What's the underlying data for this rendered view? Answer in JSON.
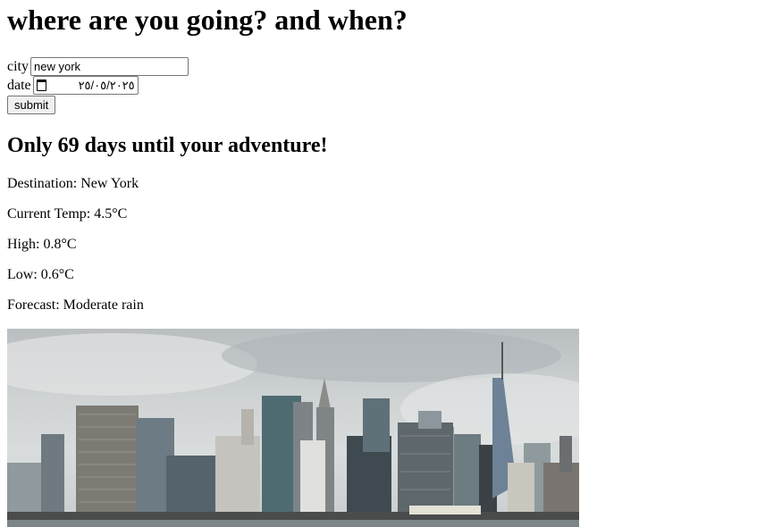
{
  "form": {
    "title": "where are you going? and when?",
    "city_label": "city",
    "city_value": "new york",
    "date_label": "date",
    "date_value": "٢٥/٠٥/٢٠٢٥",
    "submit_label": "submit"
  },
  "result": {
    "heading": "Only 69 days until your adventure!",
    "destination": "Destination: New York",
    "current_temp": "Current Temp: 4.5°C",
    "high": "High: 0.8°C",
    "low": "Low: 0.6°C",
    "forecast": "Forecast: Moderate rain"
  },
  "image": {
    "subject": "New York skyline photo"
  }
}
